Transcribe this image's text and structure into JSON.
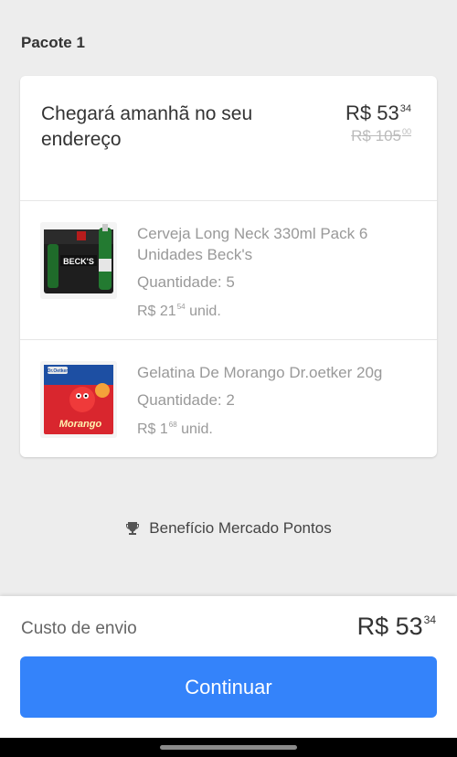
{
  "package": {
    "title": "Pacote 1"
  },
  "delivery": {
    "text": "Chegará amanhã no seu endereço",
    "price_main": "R$ 53",
    "price_cents": "34",
    "old_price_main": "R$ 105",
    "old_price_cents": "00"
  },
  "items": [
    {
      "name": "Cerveja Long Neck 330ml Pack 6 Unidades Beck's",
      "quantity": "Quantidade: 5",
      "unit_price_main": "R$ 21",
      "unit_price_cents": "54",
      "unit_suffix": "unid.",
      "image_icon": "beer-pack-image",
      "brand_text": "BECK'S"
    },
    {
      "name": "Gelatina De Morango Dr.oetker 20g",
      "quantity": "Quantidade: 2",
      "unit_price_main": "R$ 1",
      "unit_price_cents": "68",
      "unit_suffix": "unid.",
      "image_icon": "gelatin-box-image",
      "brand_text": "Dr.Oetker",
      "flavor_text": "Morango"
    }
  ],
  "benefit": {
    "text": "Benefício Mercado Pontos",
    "icon": "trophy-icon"
  },
  "shipping": {
    "label": "Custo de envio",
    "price_main": "R$ 53",
    "price_cents": "34"
  },
  "actions": {
    "continue_label": "Continuar"
  },
  "colors": {
    "primary": "#3483fa",
    "background": "#ededed"
  }
}
